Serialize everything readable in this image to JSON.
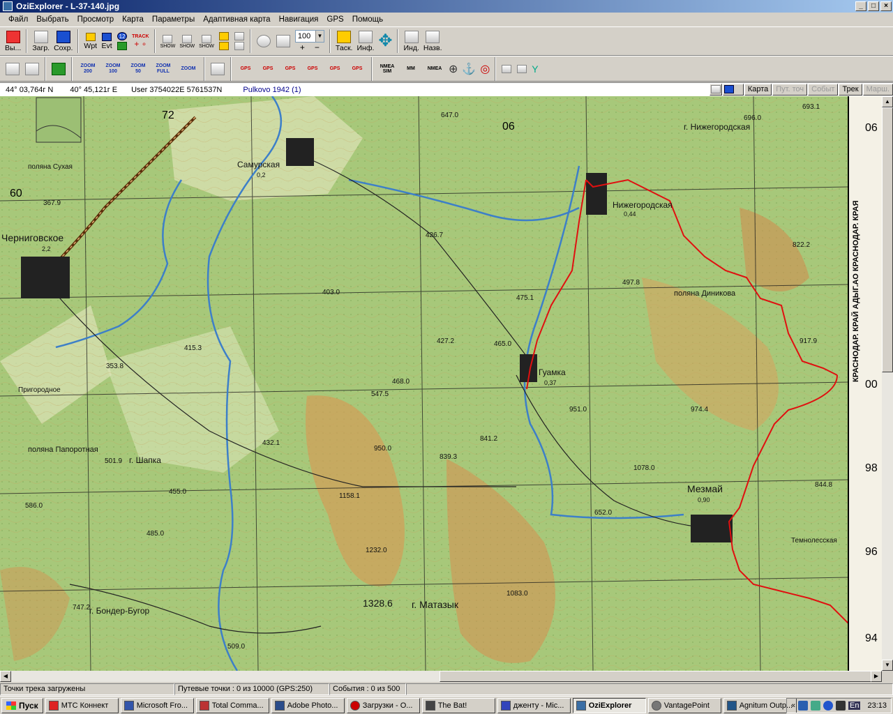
{
  "window": {
    "title": "OziExplorer - L-37-140.jpg",
    "controls": [
      "_",
      "□",
      "×"
    ]
  },
  "menu": [
    "Файл",
    "Выбрать",
    "Просмотр",
    "Карта",
    "Параметры",
    "Адаптивная карта",
    "Навигация",
    "GPS",
    "Помощь"
  ],
  "toolbar1": {
    "exit_label": "Вы...",
    "load_label": "Загр.",
    "save_label": "Сохр.",
    "wpt_label": "Wpt",
    "evt_label": "Evt",
    "wpt_count": "12",
    "track_label": "TRACK",
    "show_label": "SHOW",
    "zoom_value": "100",
    "zoom_in": "+",
    "zoom_out": "−",
    "task_label": "Таск.",
    "info_label": "Инф.",
    "ind_label": "Инд.",
    "name_label": "Назв."
  },
  "toolbar2": {
    "zooms": [
      "ZOOM 200",
      "ZOOM 100",
      "ZOOM 50",
      "ZOOM FULL",
      "ZOOM"
    ],
    "gps_buttons": [
      "GPS",
      "GPS",
      "GPS",
      "GPS",
      "GPS",
      "GPS"
    ],
    "nmea_label": "NMEA SIM",
    "mm_label": "MM",
    "nmea2_label": "NMEA"
  },
  "coords": {
    "lat": "44° 03,764г N",
    "lon": "40° 45,121г E",
    "user": "User  3754022E   5761537N",
    "datum": "Pulkovo 1942 (1)"
  },
  "right_buttons": [
    {
      "label": "Карта",
      "enabled": true
    },
    {
      "label": "Пут. точ",
      "enabled": false
    },
    {
      "label": "Событ",
      "enabled": false
    },
    {
      "label": "Трек",
      "enabled": true
    },
    {
      "label": "Марш.",
      "enabled": false
    }
  ],
  "map": {
    "grid_top": [
      "72",
      "06"
    ],
    "grid_right": [
      "06",
      "00",
      "98",
      "96",
      "94"
    ],
    "grid_left": [
      "60"
    ],
    "margin_text": "КРАСНОДАР. КРАЙ   АДЫГ.АО   КРАСНОДАР. КРАЯ",
    "places": [
      {
        "name": "Самурская",
        "pop": "0,2"
      },
      {
        "name": "Черниговское",
        "pop": "2,2"
      },
      {
        "name": "Нижегородская",
        "pop": "0,44"
      },
      {
        "name": "Гуамка",
        "pop": "0,37"
      },
      {
        "name": "Мезмай",
        "pop": "0,90"
      },
      {
        "name": "Пригородное"
      },
      {
        "name": "г. Шапка"
      },
      {
        "name": "г. Нижегородская"
      },
      {
        "name": "г. Матазык"
      },
      {
        "name": "поляна Папоротная"
      },
      {
        "name": "поляна Диникова"
      },
      {
        "name": "поляна Сухая"
      },
      {
        "name": "Темнолесская"
      },
      {
        "name": "г. Бондер-Бугор"
      }
    ],
    "heights": [
      "647.0",
      "696.0",
      "693.1",
      "367.9",
      "426.7",
      "497.8",
      "403.0",
      "475.1",
      "427.2",
      "465.0",
      "547.5",
      "468.0",
      "415.3",
      "353.8",
      "501.9",
      "432.1",
      "950.0",
      "839.3",
      "841.2",
      "951.0",
      "974.4",
      "1078.0",
      "1232.0",
      "1328.6",
      "1083.0",
      "917.9",
      "822.2",
      "844.8",
      "586.0",
      "455.0",
      "485.0",
      "1158.1",
      "652.0",
      "747.2",
      "509.0"
    ]
  },
  "status": {
    "track": "Точки трека загружены",
    "waypoints": "Путевые точки : 0 из 10000  (GPS:250)",
    "events": "События : 0 из 500"
  },
  "taskbar": {
    "start": "Пуск",
    "items": [
      "МТС Коннект",
      "Microsoft Fro...",
      "Total Comma...",
      "Adobe Photo...",
      "Загрузки - О...",
      "The Bat!",
      "дженту - Mic...",
      "OziExplorer",
      "VantagePoint",
      "Agnitum Outp..."
    ],
    "active_index": 7,
    "clock": "23:13",
    "lang": "En"
  }
}
